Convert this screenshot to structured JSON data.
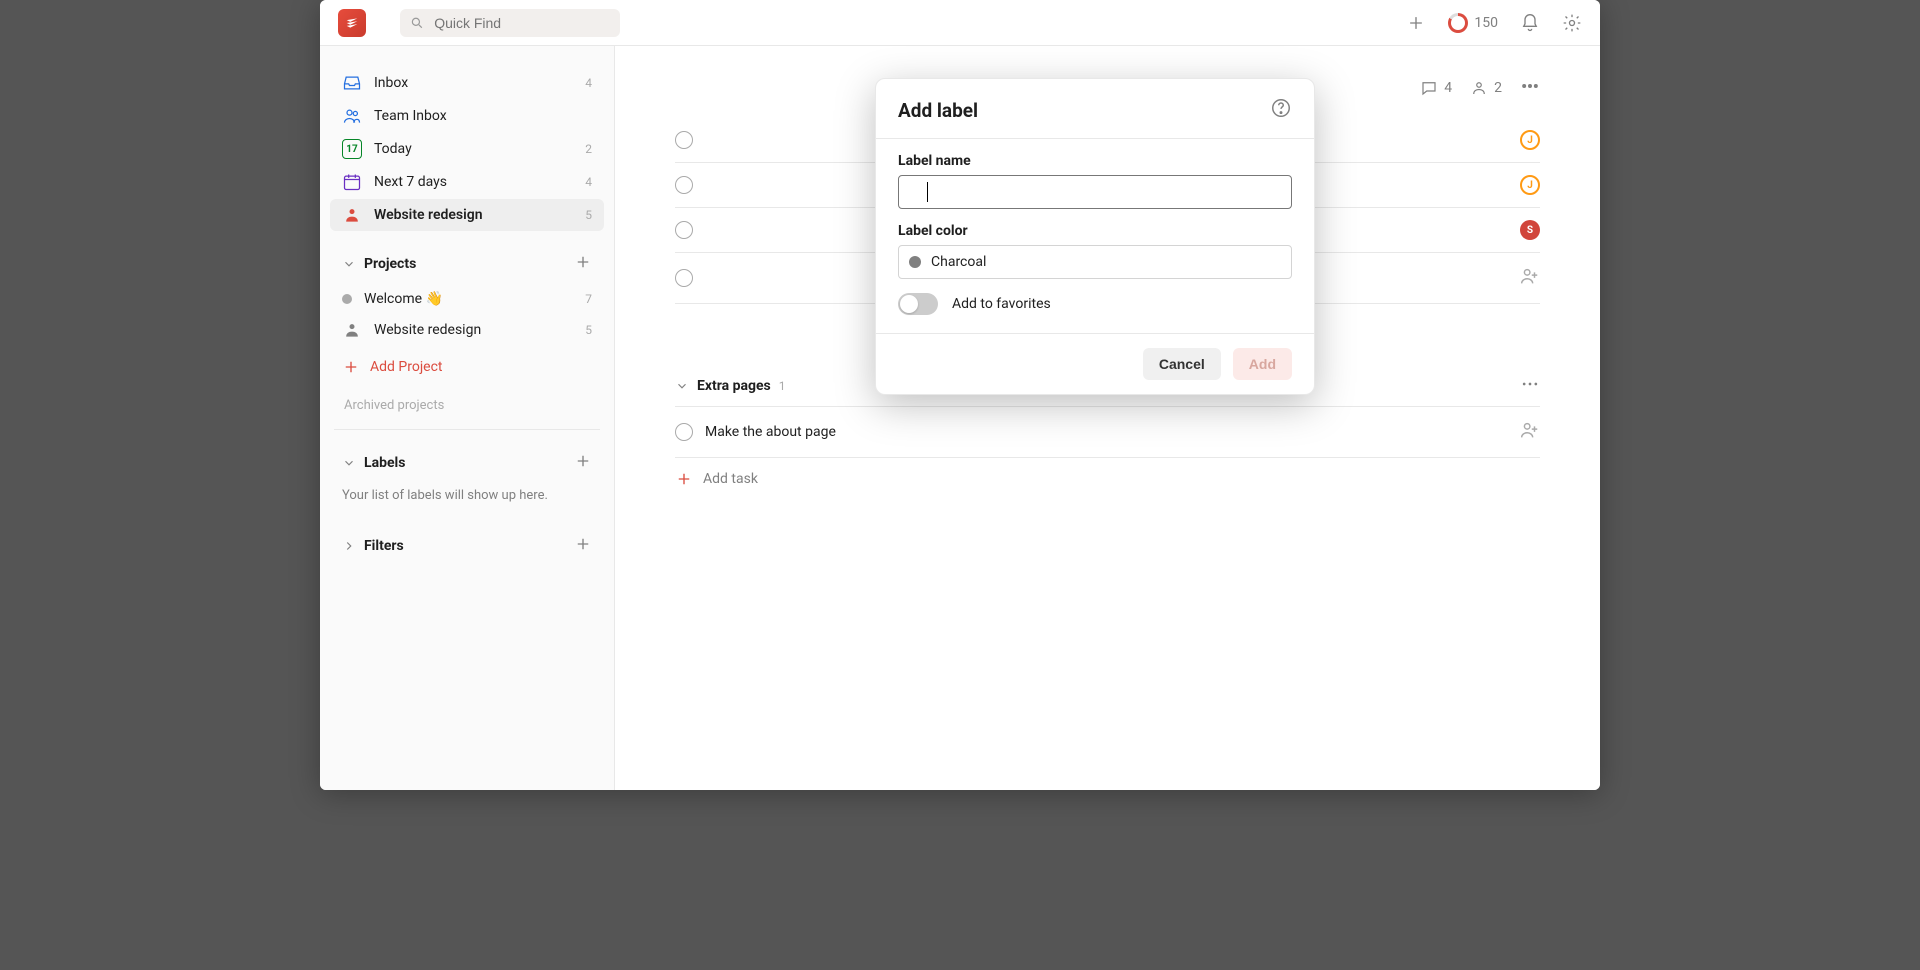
{
  "topbar": {
    "search_placeholder": "Quick Find",
    "karma": "150"
  },
  "sidebar": {
    "inbox": {
      "label": "Inbox",
      "count": "4"
    },
    "team_inbox": {
      "label": "Team Inbox"
    },
    "today": {
      "label": "Today",
      "count": "2",
      "date": "17"
    },
    "next7": {
      "label": "Next 7 days",
      "count": "4"
    },
    "website_redesign_top": {
      "label": "Website redesign",
      "count": "5"
    },
    "projects_header": "Projects",
    "projects": [
      {
        "label": "Welcome 👋",
        "count": "7"
      },
      {
        "label": "Website redesign",
        "count": "5"
      }
    ],
    "add_project": "Add Project",
    "archived": "Archived projects",
    "labels_header": "Labels",
    "labels_empty": "Your list of labels will show up here.",
    "filters_header": "Filters"
  },
  "main": {
    "comments_count": "4",
    "people_count": "2",
    "tasks_top": [
      {
        "title": "",
        "assignee": "J"
      },
      {
        "title": "",
        "assignee": "J"
      },
      {
        "title": "",
        "assignee": "S"
      },
      {
        "title": "",
        "assignee": ""
      }
    ],
    "sections": [
      {
        "title": "Extra pages",
        "count": "1",
        "tasks": [
          {
            "title": "Make the about page"
          }
        ],
        "add_task": "Add task"
      }
    ]
  },
  "modal": {
    "title": "Add label",
    "name_label": "Label name",
    "name_value": "",
    "color_label": "Label color",
    "color_name": "Charcoal",
    "color_hex": "#808080",
    "favorites_label": "Add to favorites",
    "favorites_on": false,
    "cancel": "Cancel",
    "submit": "Add"
  },
  "chart_data": null
}
